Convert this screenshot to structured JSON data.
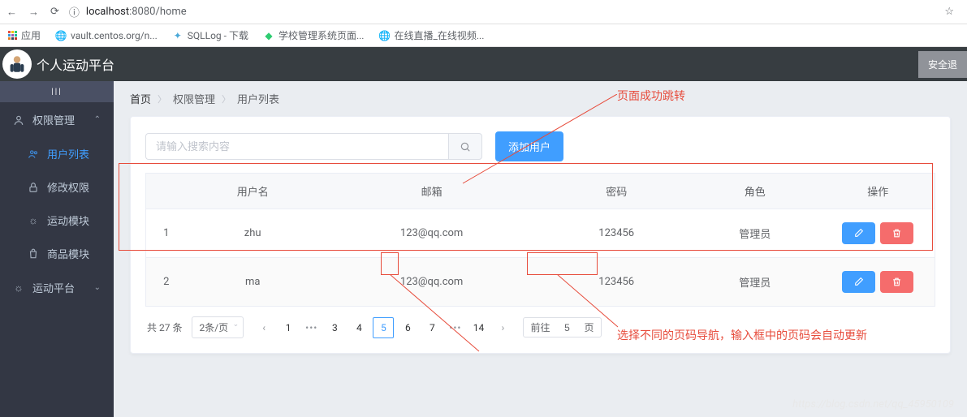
{
  "browser": {
    "url_host": "localhost",
    "url_port": ":8080",
    "url_path": "/home"
  },
  "bookmarks": {
    "apps": "应用",
    "items": [
      {
        "label": "vault.centos.org/n..."
      },
      {
        "label": "SQLLog - 下载"
      },
      {
        "label": "学校管理系统页面..."
      },
      {
        "label": "在线直播_在线视频..."
      }
    ]
  },
  "header": {
    "title": "个人运动平台",
    "logout": "安全退"
  },
  "sidebar": {
    "items": [
      {
        "label": "权限管理",
        "icon": "user",
        "hasChildren": true,
        "open": true
      },
      {
        "label": "用户列表",
        "icon": "users",
        "sub": true,
        "active": true
      },
      {
        "label": "修改权限",
        "icon": "lock",
        "sub": true
      },
      {
        "label": "运动模块",
        "icon": "sun",
        "sub": true
      },
      {
        "label": "商品模块",
        "icon": "bag",
        "sub": true
      },
      {
        "label": "运动平台",
        "icon": "sun",
        "hasChildren": true
      }
    ]
  },
  "breadcrumb": {
    "items": [
      "首页",
      "权限管理",
      "用户列表"
    ]
  },
  "search": {
    "placeholder": "请输入搜索内容"
  },
  "buttons": {
    "add_user": "添加用户"
  },
  "table": {
    "headers": [
      "用户名",
      "邮箱",
      "密码",
      "角色",
      "操作"
    ],
    "rows": [
      {
        "idx": "1",
        "username": "zhu",
        "email": "123@qq.com",
        "password": "123456",
        "role": "管理员"
      },
      {
        "idx": "2",
        "username": "ma",
        "email": "123@qq.com",
        "password": "123456",
        "role": "管理员"
      }
    ]
  },
  "pagination": {
    "total_label": "共 27 条",
    "page_size": "2条/页",
    "pages": [
      "1",
      "...",
      "3",
      "4",
      "5",
      "6",
      "7",
      "...",
      "14"
    ],
    "current": "5",
    "goto_prefix": "前往",
    "goto_value": "5",
    "goto_suffix": "页"
  },
  "annotations": {
    "ann1": "页面成功跳转",
    "ann2": "选择不同的页码导航，输入框中的页码会自动更新"
  },
  "watermark": "https://blog.csdn.net/qq_45950109"
}
